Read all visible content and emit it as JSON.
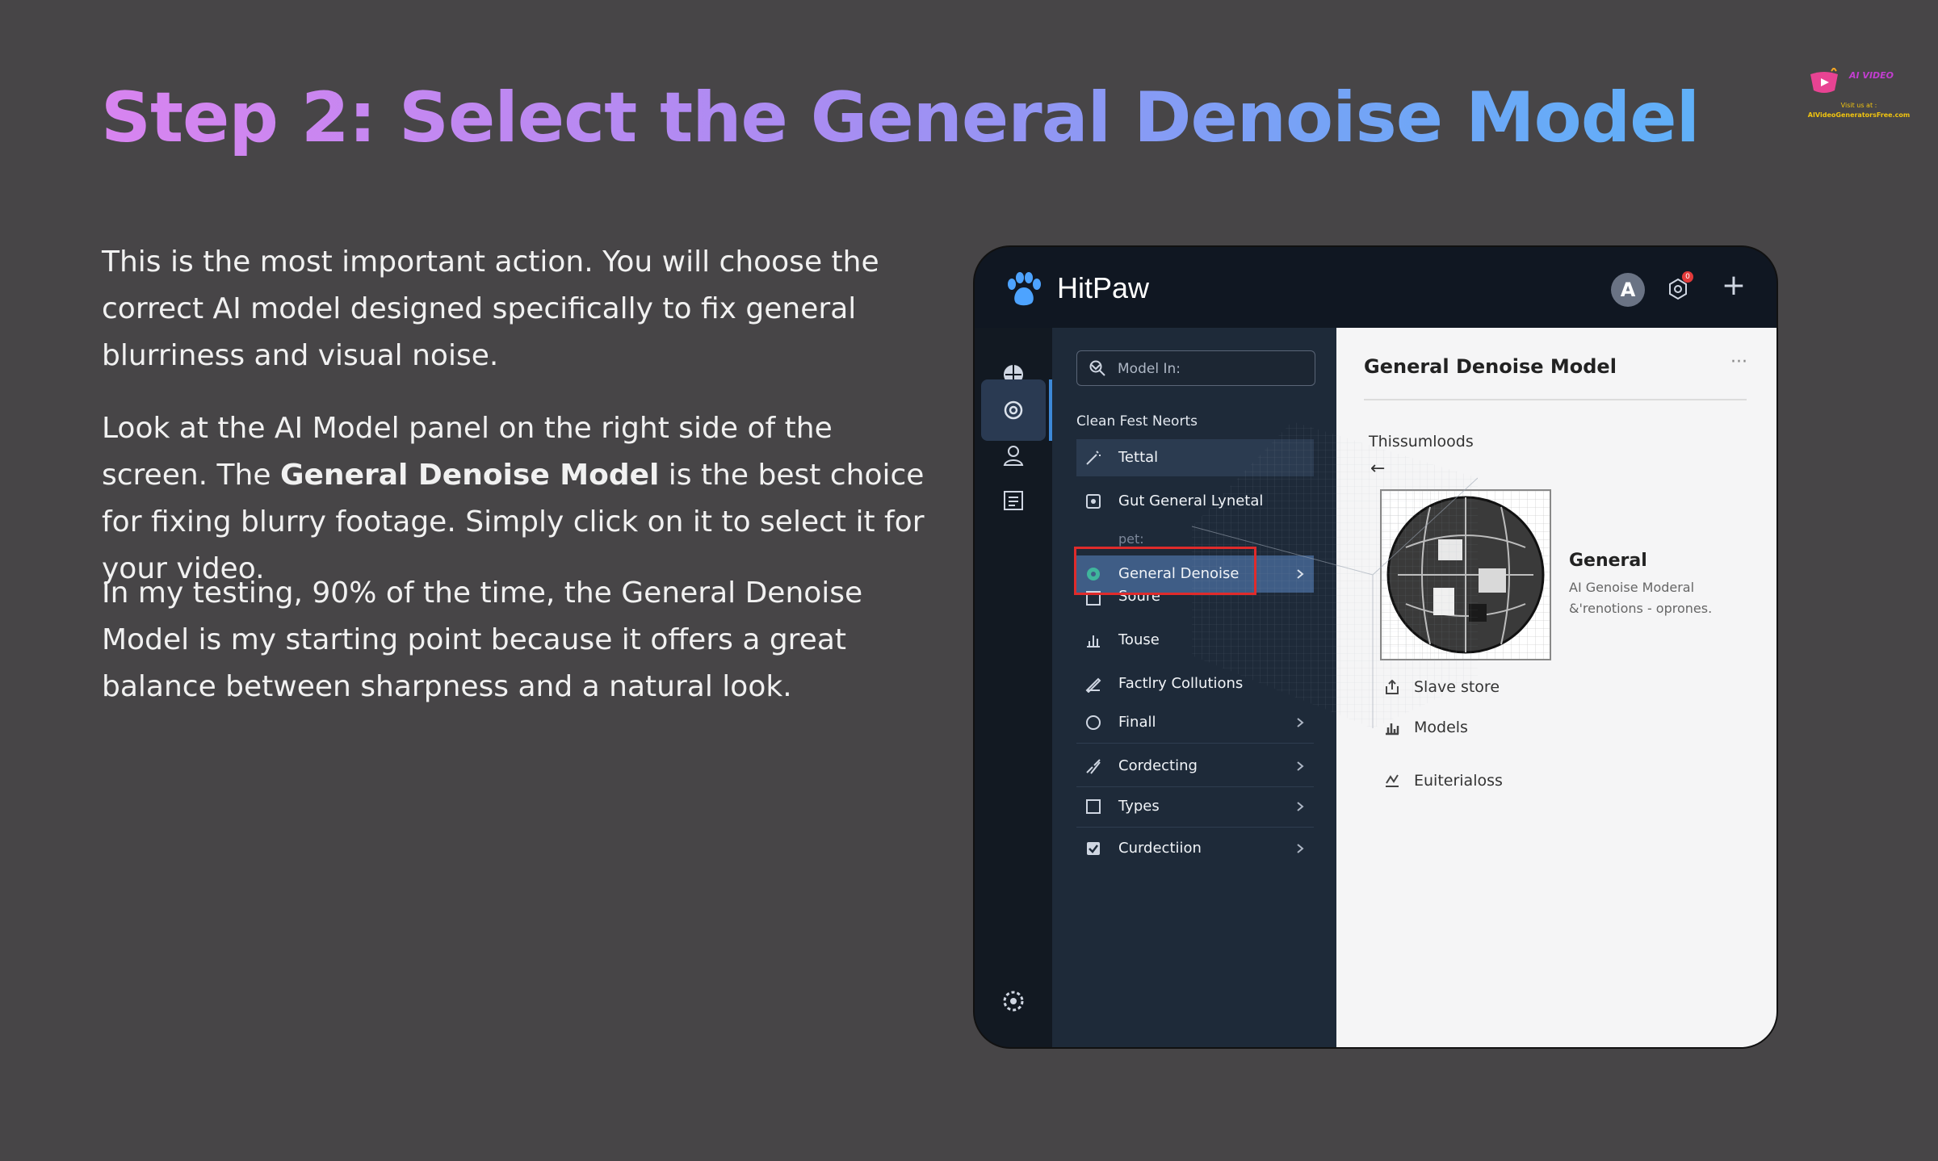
{
  "slide": {
    "title": "Step 2: Select the General Denoise Model",
    "paragraph1": "This is the most important action. You will choose the correct AI model designed specifically to fix general blurriness and visual noise.",
    "paragraph2_before": "Look at the AI Model panel on the right side of the screen. The ",
    "paragraph2_bold": "General Denoise Model",
    "paragraph2_after": " is the best choice for fixing blurry footage. Simply click on it to select it for your video.",
    "paragraph3": "In my testing, 90% of the time, the General Denoise Model is my starting point because it offers a great balance between sharpness and a natural look.",
    "logo_brand": "AI VIDEO",
    "logo_sub": "Visit us at :",
    "logo_url": "AIVideoGeneratorsFree.com"
  },
  "app": {
    "name": "HitPaw",
    "avatar_letter": "A",
    "notification_count": "0",
    "search": {
      "value": "Model In:"
    },
    "section_label": "Clean Fest Neorts",
    "items": [
      {
        "label": "Tettal",
        "icon": "wand-icon"
      },
      {
        "label": "Gut General Lynetal",
        "icon": "frame-icon"
      },
      {
        "label": "General Denoise",
        "icon": "gear-icon",
        "selected": true
      },
      {
        "label": "Soure",
        "icon": "square-icon"
      },
      {
        "label": "Touse",
        "icon": "chart-icon"
      },
      {
        "label": "Factlry Collutions",
        "icon": "pen-icon"
      },
      {
        "label": "Finall",
        "icon": "circle-icon"
      },
      {
        "label": "Cordecting",
        "icon": "brush-icon"
      },
      {
        "label": "Types",
        "icon": "checkbox-icon"
      },
      {
        "label": "Curdectiion",
        "icon": "checkbox-checked-icon"
      }
    ],
    "item_sub_label": "pet:",
    "panel": {
      "title": "General Denoise Model",
      "more": "···",
      "section": "Thissumloods",
      "back": "←",
      "model_name": "General",
      "model_desc_line1": "AI Genoise Moderal",
      "model_desc_line2": "&'renotions - oprones.",
      "links": [
        "Slave store",
        "Models",
        "Euiterialoss"
      ]
    }
  }
}
